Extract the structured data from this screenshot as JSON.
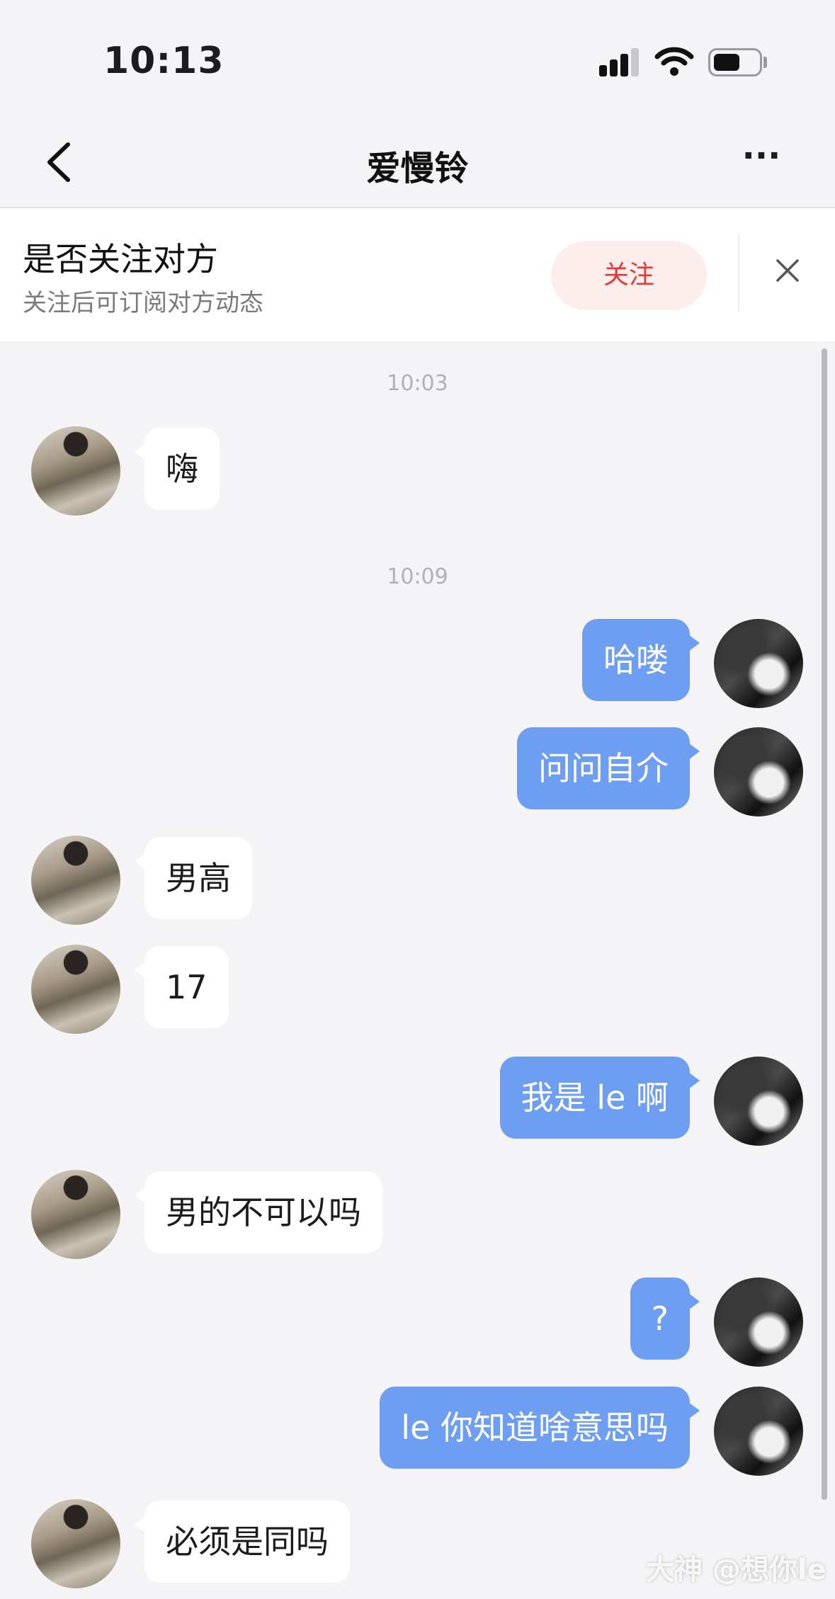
{
  "status_bar": {
    "time": "10:13"
  },
  "nav": {
    "title": "爱慢铃",
    "more_label": "···"
  },
  "follow_banner": {
    "title": "是否关注对方",
    "subtitle": "关注后可订阅对方动态",
    "follow_label": "关注"
  },
  "messages": [
    {
      "type": "timestamp",
      "text": "10:03"
    },
    {
      "type": "them",
      "text": "嗨"
    },
    {
      "type": "timestamp",
      "text": "10:09"
    },
    {
      "type": "me",
      "text": "哈喽"
    },
    {
      "type": "me",
      "text": "问问自介"
    },
    {
      "type": "them",
      "text": "男高"
    },
    {
      "type": "them",
      "text": "17"
    },
    {
      "type": "me",
      "text": "我是 le 啊"
    },
    {
      "type": "them",
      "text": "男的不可以吗"
    },
    {
      "type": "me",
      "text": "?"
    },
    {
      "type": "me",
      "text": "le 你知道啥意思吗"
    },
    {
      "type": "them",
      "text": "必须是同吗"
    }
  ],
  "watermark": "大神 @想你le",
  "colors": {
    "my_bubble": "#6e9ef2",
    "their_bubble": "#ffffff",
    "follow_button_bg": "#fdeeee",
    "follow_button_text": "#e53935",
    "background": "#f4f4f7"
  }
}
